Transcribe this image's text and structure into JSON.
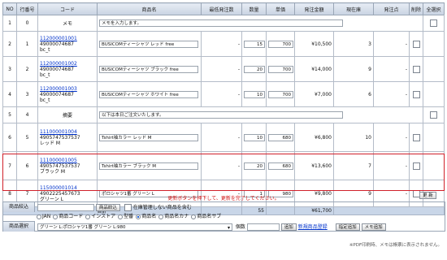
{
  "columns": [
    "NO",
    "行番号",
    "コード",
    "商品名",
    "最低発注数",
    "数量",
    "単価",
    "発注金額",
    "現在庫",
    "発注点",
    "削除",
    "全選択"
  ],
  "rows": [
    {
      "no": "1",
      "line": "0",
      "codes": [
        "メモ"
      ],
      "name": "メモを入力します。",
      "min": "",
      "qty": "",
      "price": "",
      "amount": "",
      "stock": "",
      "point": "",
      "type": "memo"
    },
    {
      "no": "2",
      "line": "1",
      "codes": [
        "112000001001",
        "49000074687",
        "bc_t"
      ],
      "name": "BUSICOMティーシャツ レッド free",
      "min": "-",
      "qty": "15",
      "price": "700",
      "amount": "¥10,500",
      "stock": "3",
      "point": "-",
      "type": "item"
    },
    {
      "no": "3",
      "line": "2",
      "codes": [
        "112000001002",
        "49000074687",
        "bc_t"
      ],
      "name": "BUSICOMティーシャツ ブラック free",
      "min": "-",
      "qty": "20",
      "price": "700",
      "amount": "¥14,000",
      "stock": "9",
      "point": "-",
      "type": "item"
    },
    {
      "no": "4",
      "line": "3",
      "codes": [
        "112000001003",
        "49000074687",
        "bc_t"
      ],
      "name": "BUSICOMティーシャツ ホワイト free",
      "min": "-",
      "qty": "10",
      "price": "700",
      "amount": "¥7,000",
      "stock": "6",
      "point": "-",
      "type": "item"
    },
    {
      "no": "5",
      "line": "4",
      "codes": [
        "摘要"
      ],
      "name": "以下は本日ご注文いたします。",
      "min": "",
      "qty": "",
      "price": "",
      "amount": "",
      "stock": "",
      "point": "",
      "type": "memo"
    },
    {
      "no": "6",
      "line": "5",
      "codes": [
        "111000001004",
        "4905747537537",
        "レッド M"
      ],
      "name": "Tshirt袖カラー レッド M",
      "min": "-",
      "qty": "10",
      "price": "680",
      "amount": "¥6,800",
      "stock": "10",
      "point": "-",
      "type": "item"
    },
    {
      "no": "7",
      "line": "6",
      "codes": [
        "111000001005",
        "4905747537537",
        "ブラック M"
      ],
      "name": "Tshirt袖カラー ブラック M",
      "min": "-",
      "qty": "20",
      "price": "680",
      "amount": "¥13,600",
      "stock": "7",
      "point": "-",
      "type": "item"
    },
    {
      "no": "8",
      "line": "7",
      "codes": [
        "115000001014",
        "4902225457673",
        "グリーン L"
      ],
      "name": "ポロシャツ1番 グリーン L",
      "min": "-",
      "qty": "1",
      "price": "980",
      "amount": "¥9,800",
      "stock": "9",
      "point": "-",
      "type": "item"
    }
  ],
  "total": {
    "label": "合計",
    "qty": "55",
    "amount": "¥61,700"
  },
  "message": "更新ボタンを押下して、更新を完了してください。",
  "update_button": "更 新",
  "search": {
    "narrow_label": "商品絞込",
    "narrow_button": "商品絞込",
    "stock_checkbox_label": "在庫管理しない商品を含む",
    "radio_options": [
      "JAN",
      "商品コード",
      "インストア",
      "型番",
      "商品名",
      "商品名カナ",
      "商品名サブ"
    ],
    "selected_radio": "商品名",
    "select_label": "商品選択",
    "select_value": "グリーン L:ポロシャツ1番 グリーン L:980",
    "qty_label": "個数",
    "add_button": "追加",
    "register_link": "新規商品登録",
    "reset_button": "指定追加",
    "memo_button": "メモ追加"
  },
  "footnote": "※PDF印刷時、メモは帳票に表示されません。",
  "colors": {
    "header": "#c9d3e2",
    "total_row": "#c9d6e8",
    "highlight_border": "#d0202a",
    "message": "#d01010",
    "link": "#0033cc"
  }
}
